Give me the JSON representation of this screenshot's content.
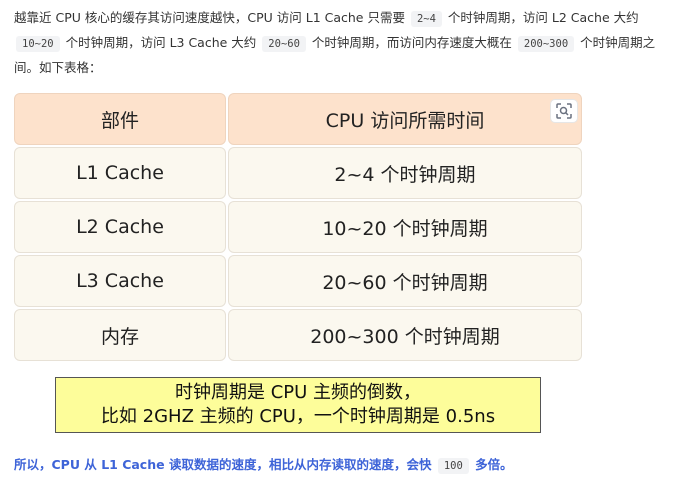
{
  "intro": {
    "t1": "越靠近 CPU 核心的缓存其访问速度越快，CPU 访问 L1 Cache 只需要",
    "c1": "2~4",
    "t2": "个时钟周期，访问 L2 Cache 大约",
    "c2": "10~20",
    "t3": "个时钟周期，访问 L3 Cache 大约",
    "c3": "20~60",
    "t4": "个时钟周期，而访问内存速度大概在",
    "c4": "200~300",
    "t5": "个时钟周期之间。如下表格："
  },
  "table": {
    "header": {
      "col1": "部件",
      "col2": "CPU 访问所需时间"
    },
    "rows": [
      {
        "part": "L1 Cache",
        "time": "2~4 个时钟周期"
      },
      {
        "part": "L2 Cache",
        "time": "10~20 个时钟周期"
      },
      {
        "part": "L3 Cache",
        "time": "20~60 个时钟周期"
      },
      {
        "part": "内存",
        "time": "200~300 个时钟周期"
      }
    ],
    "action_icon": "scan-icon"
  },
  "note": {
    "line1": "时钟周期是 CPU 主频的倒数，",
    "line2": "比如 2GHZ 主频的 CPU，一个时钟周期是 0.5ns"
  },
  "conclusion": {
    "t1": "所以，CPU 从 L1 Cache 读取数据的速度，相比从内存读取的速度，会快",
    "code": "100",
    "t2": "多倍。"
  },
  "colors": {
    "header_bg": "#fde2cc",
    "cell_bg": "#fbf8ef",
    "note_bg": "#fdfd9a",
    "conclusion_text": "#3e64d8"
  }
}
